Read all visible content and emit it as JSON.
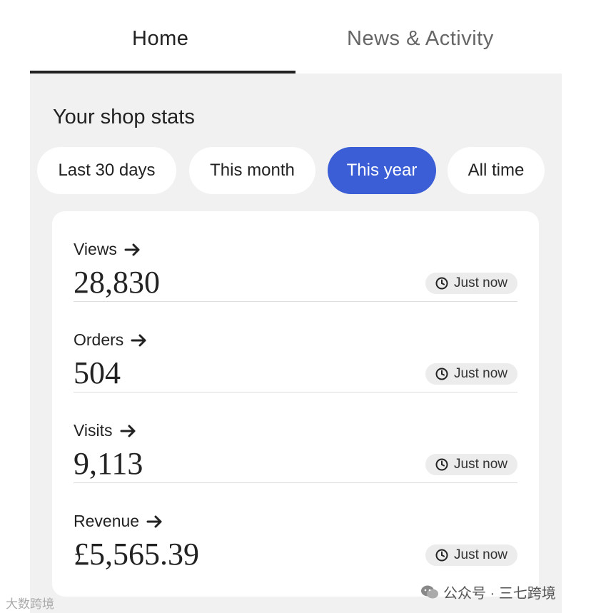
{
  "tabs": {
    "home": "Home",
    "news": "News & Activity"
  },
  "section_title": "Your shop stats",
  "filters": [
    {
      "label": "Last 30 days",
      "active": false
    },
    {
      "label": "This month",
      "active": false
    },
    {
      "label": "This year",
      "active": true
    },
    {
      "label": "All time",
      "active": false
    }
  ],
  "stats": [
    {
      "label": "Views",
      "value": "28,830",
      "updated": "Just now"
    },
    {
      "label": "Orders",
      "value": "504",
      "updated": "Just now"
    },
    {
      "label": "Visits",
      "value": "9,113",
      "updated": "Just now"
    },
    {
      "label": "Revenue",
      "value": "£5,565.39",
      "updated": "Just now"
    }
  ],
  "colors": {
    "accent": "#3b5ed6",
    "panel": "#f1f1f1"
  },
  "watermarks": {
    "right": "公众号 · 三七跨境",
    "left": "大数跨境"
  }
}
